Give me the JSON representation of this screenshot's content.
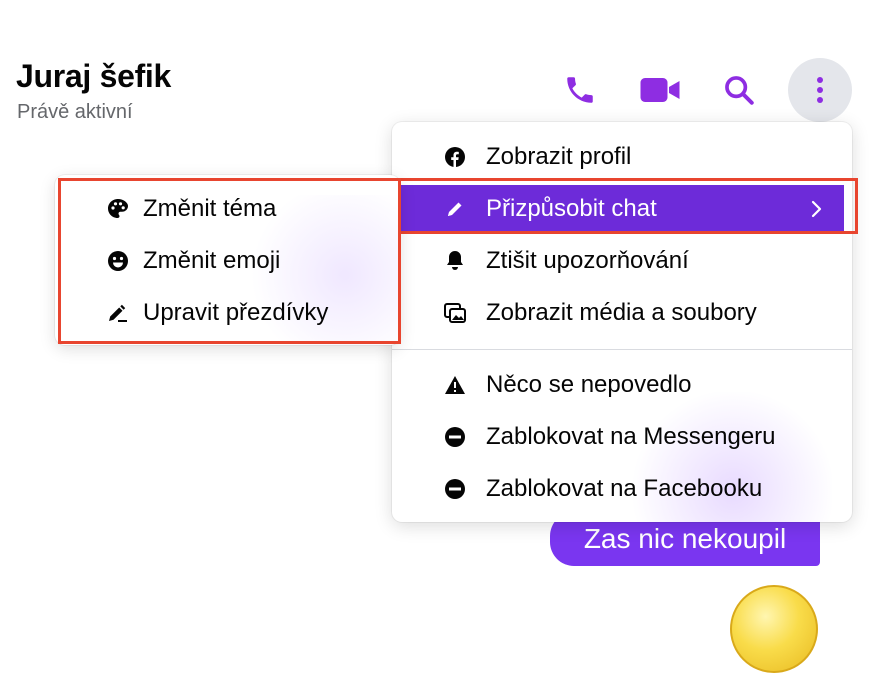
{
  "header": {
    "name": "Juraj šefik",
    "status": "Právě aktivní"
  },
  "toolbar": {
    "icons": [
      "phone-icon",
      "video-icon",
      "search-icon",
      "more-icon"
    ],
    "accent_color": "#8e2de2"
  },
  "menu": {
    "items": [
      {
        "label": "Zobrazit profil",
        "icon": "facebook-icon"
      },
      {
        "label": "Přizpůsobit chat",
        "icon": "pencil-icon",
        "active": true,
        "has_submenu": true
      },
      {
        "label": "Ztišit upozorňování",
        "icon": "bell-icon"
      },
      {
        "label": "Zobrazit média a soubory",
        "icon": "media-icon"
      },
      {
        "label": "Něco se nepovedlo",
        "icon": "warning-icon"
      },
      {
        "label": "Zablokovat na Messengeru",
        "icon": "block-icon"
      },
      {
        "label": "Zablokovat na Facebooku",
        "icon": "block-icon"
      }
    ],
    "active_color": "#6d2bd9"
  },
  "submenu": {
    "items": [
      {
        "label": "Změnit téma",
        "icon": "palette-icon"
      },
      {
        "label": "Změnit emoji",
        "icon": "smiley-icon"
      },
      {
        "label": "Upravit přezdívky",
        "icon": "edit-nickname-icon"
      }
    ]
  },
  "message": {
    "text": "Zas nic nekoupil",
    "bubble_color": "#7a36f0"
  },
  "highlight_color": "#e8452f"
}
